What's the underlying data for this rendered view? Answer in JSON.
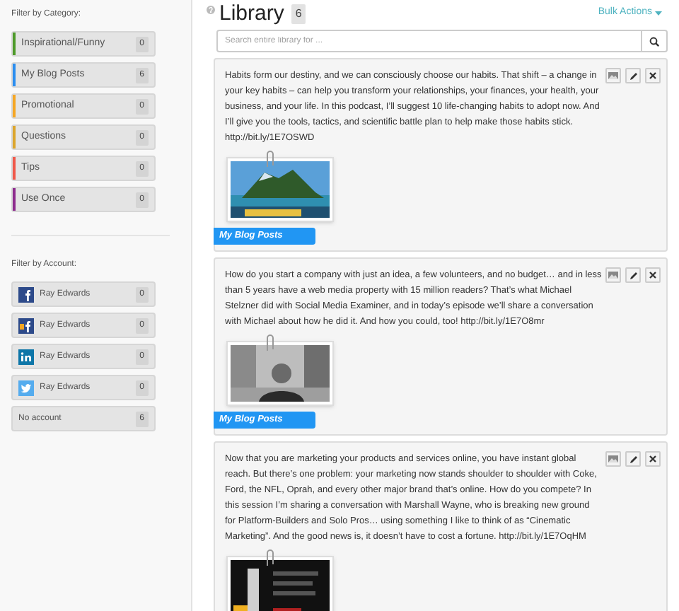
{
  "sidebar": {
    "category_heading": "Filter by Category:",
    "categories": [
      {
        "label": "Inspirational/Funny",
        "count": "0",
        "color": "#4e9a2a"
      },
      {
        "label": "My Blog Posts",
        "count": "6",
        "color": "#2b8ef0"
      },
      {
        "label": "Promotional",
        "count": "0",
        "color": "#f5a623"
      },
      {
        "label": "Questions",
        "count": "0",
        "color": "#dca52c"
      },
      {
        "label": "Tips",
        "count": "0",
        "color": "#f0584a"
      },
      {
        "label": "Use Once",
        "count": "0",
        "color": "#8e2c8e"
      }
    ],
    "account_heading": "Filter by Account:",
    "accounts": [
      {
        "name": "Ray Edwards",
        "count": "0",
        "kind": "facebook"
      },
      {
        "name": "Ray Edwards",
        "count": "0",
        "kind": "facebook_page"
      },
      {
        "name": "Ray Edwards",
        "count": "0",
        "kind": "linkedin"
      },
      {
        "name": "Ray Edwards",
        "count": "0",
        "kind": "twitter"
      },
      {
        "name": "No account",
        "count": "6",
        "kind": "none"
      }
    ]
  },
  "main": {
    "title": "Library",
    "count": "6",
    "bulk_actions": "Bulk Actions",
    "search": {
      "placeholder": "Search entire library for ..."
    },
    "posts": [
      {
        "text": "Habits form our destiny, and we can consciously choose our habits. That shift – a change in your key habits – can help you transform your relationships, your finances, your health, your business, and your life. In this podcast, I’ll suggest 10 life-changing habits to adopt now. And I’ll give you the tools, tactics, and scientific battle plan to help make those habits stick. http://bit.ly/1E7OSWD",
        "tag": "My Blog Posts"
      },
      {
        "text": "How do you start a company with just an idea, a few volunteers, and no budget… and in less than 5 years have a web media property with 15 million readers? That’s what Michael Stelzner did with Social Media Examiner, and in today’s episode we’ll share a conversation with Michael about how he did it. And how you could, too! http://bit.ly/1E7O8mr",
        "tag": "My Blog Posts"
      },
      {
        "text": "Now that you are marketing your products and services online, you have instant global reach. But there’s one problem: your marketing now stands shoulder to shoulder with Coke, Ford, the NFL, Oprah, and every other major brand that’s online. How do you compete? In this session I’m sharing a conversation with Marshall Wayne, who is breaking new ground for Platform-Builders and Solo Pros… using something I like to think of as “Cinematic Marketing”. And the good news is, it doesn’t have to cost a fortune. http://bit.ly/1E7OqHM"
      }
    ]
  }
}
